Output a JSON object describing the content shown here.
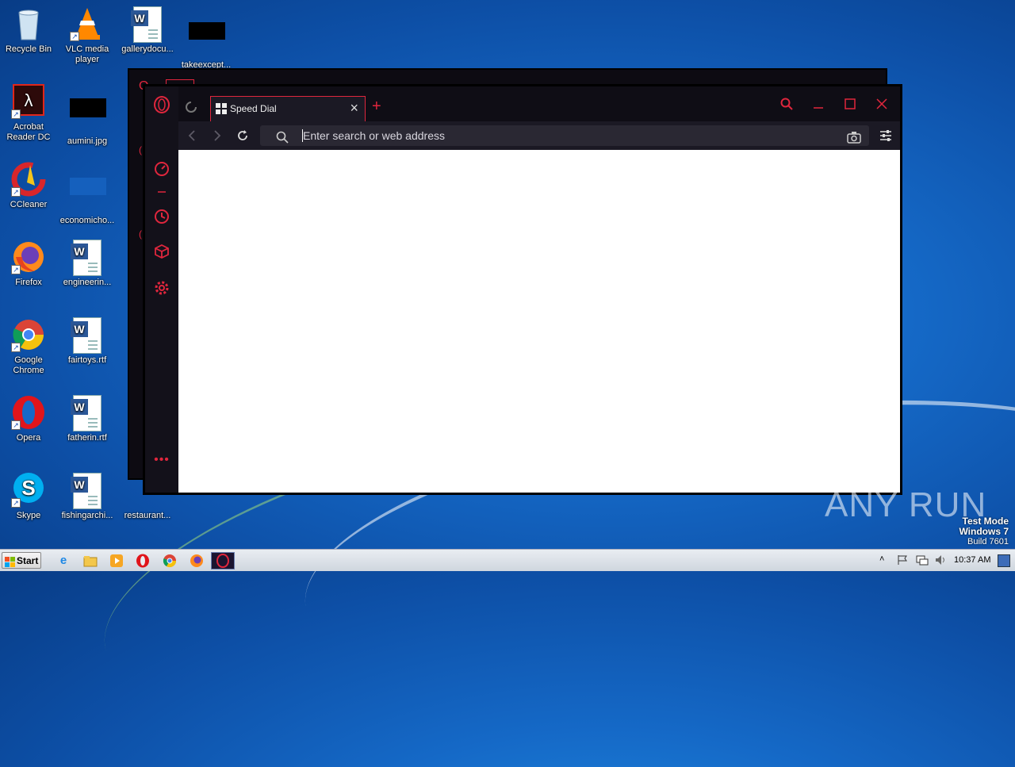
{
  "desktop": {
    "icons": [
      {
        "label": "Recycle Bin",
        "type": "recycle"
      },
      {
        "label": "VLC media\nplayer",
        "type": "vlc"
      },
      {
        "label": "gallerydocu...",
        "type": "word"
      },
      {
        "label": "takeexcept...",
        "type": "black"
      },
      {
        "label": "Acrobat\nReader DC",
        "type": "acrobat"
      },
      {
        "label": "aumini.jpg",
        "type": "black"
      },
      {
        "label": "CCleaner",
        "type": "ccleaner"
      },
      {
        "label": "economicho...",
        "type": "blue"
      },
      {
        "label": "Firefox",
        "type": "firefox"
      },
      {
        "label": "engineerin...",
        "type": "word"
      },
      {
        "label": "Google\nChrome",
        "type": "chrome"
      },
      {
        "label": "fairtoys.rtf",
        "type": "word"
      },
      {
        "label": "Opera",
        "type": "opera"
      },
      {
        "label": "fatherin.rtf",
        "type": "word"
      },
      {
        "label": "Skype",
        "type": "skype"
      },
      {
        "label": "fishingarchi...",
        "type": "word"
      },
      {
        "label": "restaurant...",
        "type": "word"
      }
    ]
  },
  "browser": {
    "tab_title": "Speed Dial",
    "new_tab_glyph": "+",
    "address_placeholder": "Enter search or web address",
    "accent_color": "#e0263d"
  },
  "taskbar": {
    "start_label": "Start",
    "clock": "10:37 AM"
  },
  "watermark": {
    "brand": "ANY RUN",
    "line1": "Test Mode",
    "line2": "Windows 7",
    "line3": "Build 7601"
  }
}
